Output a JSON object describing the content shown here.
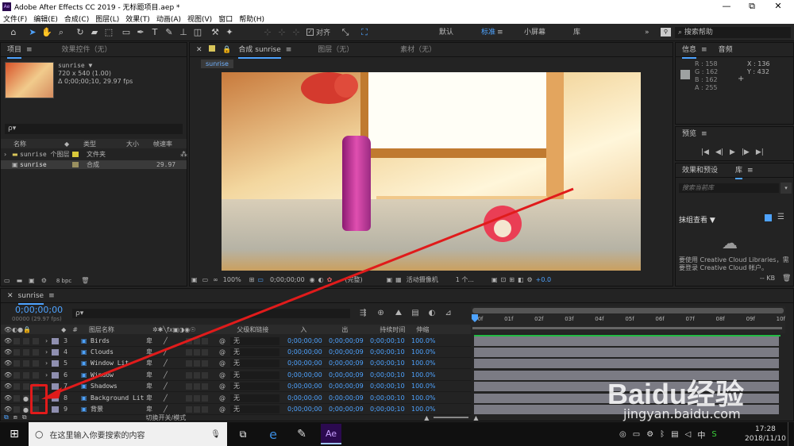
{
  "window": {
    "title": "Adobe After Effects CC 2019 - 无标题项目.aep *",
    "app_icon": "Ae",
    "minimize": "—",
    "restore": "⧉",
    "close": "✕"
  },
  "menu": [
    "文件(F)",
    "编辑(E)",
    "合成(C)",
    "图层(L)",
    "效果(T)",
    "动画(A)",
    "视图(V)",
    "窗口",
    "帮助(H)"
  ],
  "toolbar": {
    "snap_label": "对齐",
    "workspaces": [
      "默认",
      "标准",
      "小屏幕",
      "库"
    ],
    "active_workspace": "标准",
    "search_placeholder": "搜索帮助",
    "more": "»"
  },
  "project": {
    "tab": "项目",
    "effects_tab": "效果控件（无）",
    "comp_name": "sunrise ▼",
    "comp_size": "720 x 540 (1.00)",
    "comp_duration": "Δ 0;00;00;10, 29.97 fps",
    "search_placeholder": "ρ▾",
    "columns": [
      "名称",
      "类型",
      "大小",
      "帧速率"
    ],
    "items": [
      {
        "name": "sunrise 个图层",
        "type": "文件夹",
        "size": "",
        "fps": "",
        "color": "#d9c83a"
      },
      {
        "name": "sunrise",
        "type": "合成",
        "size": "",
        "fps": "29.97",
        "color": "#9a9060"
      }
    ],
    "bpc": "8 bpc"
  },
  "composition": {
    "tab": "合成 sunrise",
    "layer_tab": "图层（无）",
    "footage_tab": "素材（无）",
    "sub_tab": "sunrise",
    "zoom": "100%",
    "timecode": "0;00;00;00",
    "resolution": "(完整)",
    "camera": "活动摄像机",
    "views": "1 个...",
    "exposure": "+0.0"
  },
  "info": {
    "tab": "信息",
    "audio_tab": "音频",
    "R": "R : 158",
    "G": "G : 162",
    "B": "B : 162",
    "A": "A : 255",
    "X": "X : 136",
    "Y": "Y : 432",
    "swatch": "#9ea2a2"
  },
  "preview": {
    "tab": "预览",
    "controls": [
      "|◀",
      "◀|",
      "▶",
      "|▶",
      "▶|"
    ]
  },
  "effects": {
    "tab": "效果和预设",
    "lib_tab": "库",
    "search_placeholder": "搜索当前库",
    "lib_label": "抹组查看 ▼",
    "cloud_msg": "要使用 Creative Cloud Libraries，需要登录 Creative Cloud 帐户。",
    "kb": "-- KB"
  },
  "timeline": {
    "tab": "sunrise",
    "time": "0;00;00;00",
    "fps_note": "00000 (29.97 fps)",
    "search_placeholder": "ρ▾",
    "headers": [
      "#",
      "图层名称",
      "父级和链接",
      "入",
      "出",
      "持续时间",
      "伸缩"
    ],
    "ruler": [
      "00f",
      "01f",
      "02f",
      "03f",
      "04f",
      "05f",
      "06f",
      "07f",
      "08f",
      "09f",
      "10f"
    ],
    "layers": [
      {
        "num": "3",
        "name": "Birds",
        "parent": "无",
        "in": "0;00;00;00",
        "out": "0;00;00;09",
        "dur": "0;00;00;10",
        "stretch": "100.0%"
      },
      {
        "num": "4",
        "name": "Clouds",
        "parent": "无",
        "in": "0;00;00;00",
        "out": "0;00;00;09",
        "dur": "0;00;00;10",
        "stretch": "100.0%"
      },
      {
        "num": "5",
        "name": "Window Lit",
        "parent": "无",
        "in": "0;00;00;00",
        "out": "0;00;00;09",
        "dur": "0;00;00;10",
        "stretch": "100.0%"
      },
      {
        "num": "6",
        "name": "Window",
        "parent": "无",
        "in": "0;00;00;00",
        "out": "0;00;00;09",
        "dur": "0;00;00;10",
        "stretch": "100.0%"
      },
      {
        "num": "7",
        "name": "Shadows",
        "parent": "无",
        "in": "0;00;00;00",
        "out": "0;00;00;09",
        "dur": "0;00;00;10",
        "stretch": "100.0%"
      },
      {
        "num": "8",
        "name": "Background Lit",
        "parent": "无",
        "in": "0;00;00;00",
        "out": "0;00;00;09",
        "dur": "0;00;00;10",
        "stretch": "100.0%"
      },
      {
        "num": "9",
        "name": "背景",
        "parent": "无",
        "in": "0;00;00;00",
        "out": "0;00;00;09",
        "dur": "0;00;00;10",
        "stretch": "100.0%"
      }
    ],
    "footer_toggle": "切换开关/模式"
  },
  "taskbar": {
    "search_text": "在这里输入你要搜索的内容",
    "time": "17:28",
    "date": "2018/11/10",
    "ime": "中"
  },
  "watermark": {
    "logo": "Baidu经验",
    "url": "jingyan.baidu.com"
  }
}
